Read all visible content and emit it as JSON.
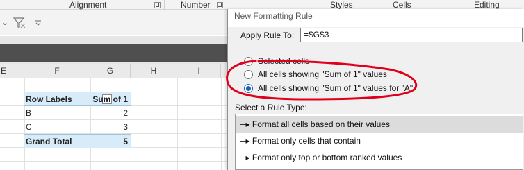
{
  "ribbon": {
    "groups": [
      {
        "label": "Alignment"
      },
      {
        "label": "Number"
      },
      {
        "label": "Styles"
      },
      {
        "label": "Cells"
      },
      {
        "label": "Editing"
      }
    ]
  },
  "sheet": {
    "columns": [
      "E",
      "F",
      "G",
      "H",
      "I"
    ],
    "pivot": {
      "header": {
        "row_labels": "Row Labels",
        "value_header": "Sum of 1"
      },
      "rows": [
        {
          "label": "B",
          "value": "2"
        },
        {
          "label": "C",
          "value": "3"
        }
      ],
      "total": {
        "label": "Grand Total",
        "value": "5"
      }
    }
  },
  "dialog": {
    "title": "New Formatting Rule",
    "apply_rule_label": "Apply Rule To:",
    "apply_rule_value": "=$G$3",
    "radio_options": [
      {
        "label": "Selected cells",
        "checked": false
      },
      {
        "label": "All cells showing \"Sum of 1\" values",
        "checked": false
      },
      {
        "label": "All cells showing \"Sum of 1\" values for \"A\"",
        "checked": true
      }
    ],
    "rule_type_label": "Select a Rule Type:",
    "rule_types": [
      "Format all cells based on their values",
      "Format only cells that contain",
      "Format only top or bottom ranked values"
    ]
  },
  "colors": {
    "pivot_header_bg": "#d7ecf8",
    "annotation_red": "#e0001b",
    "radio_accent": "#1a5fb4"
  }
}
